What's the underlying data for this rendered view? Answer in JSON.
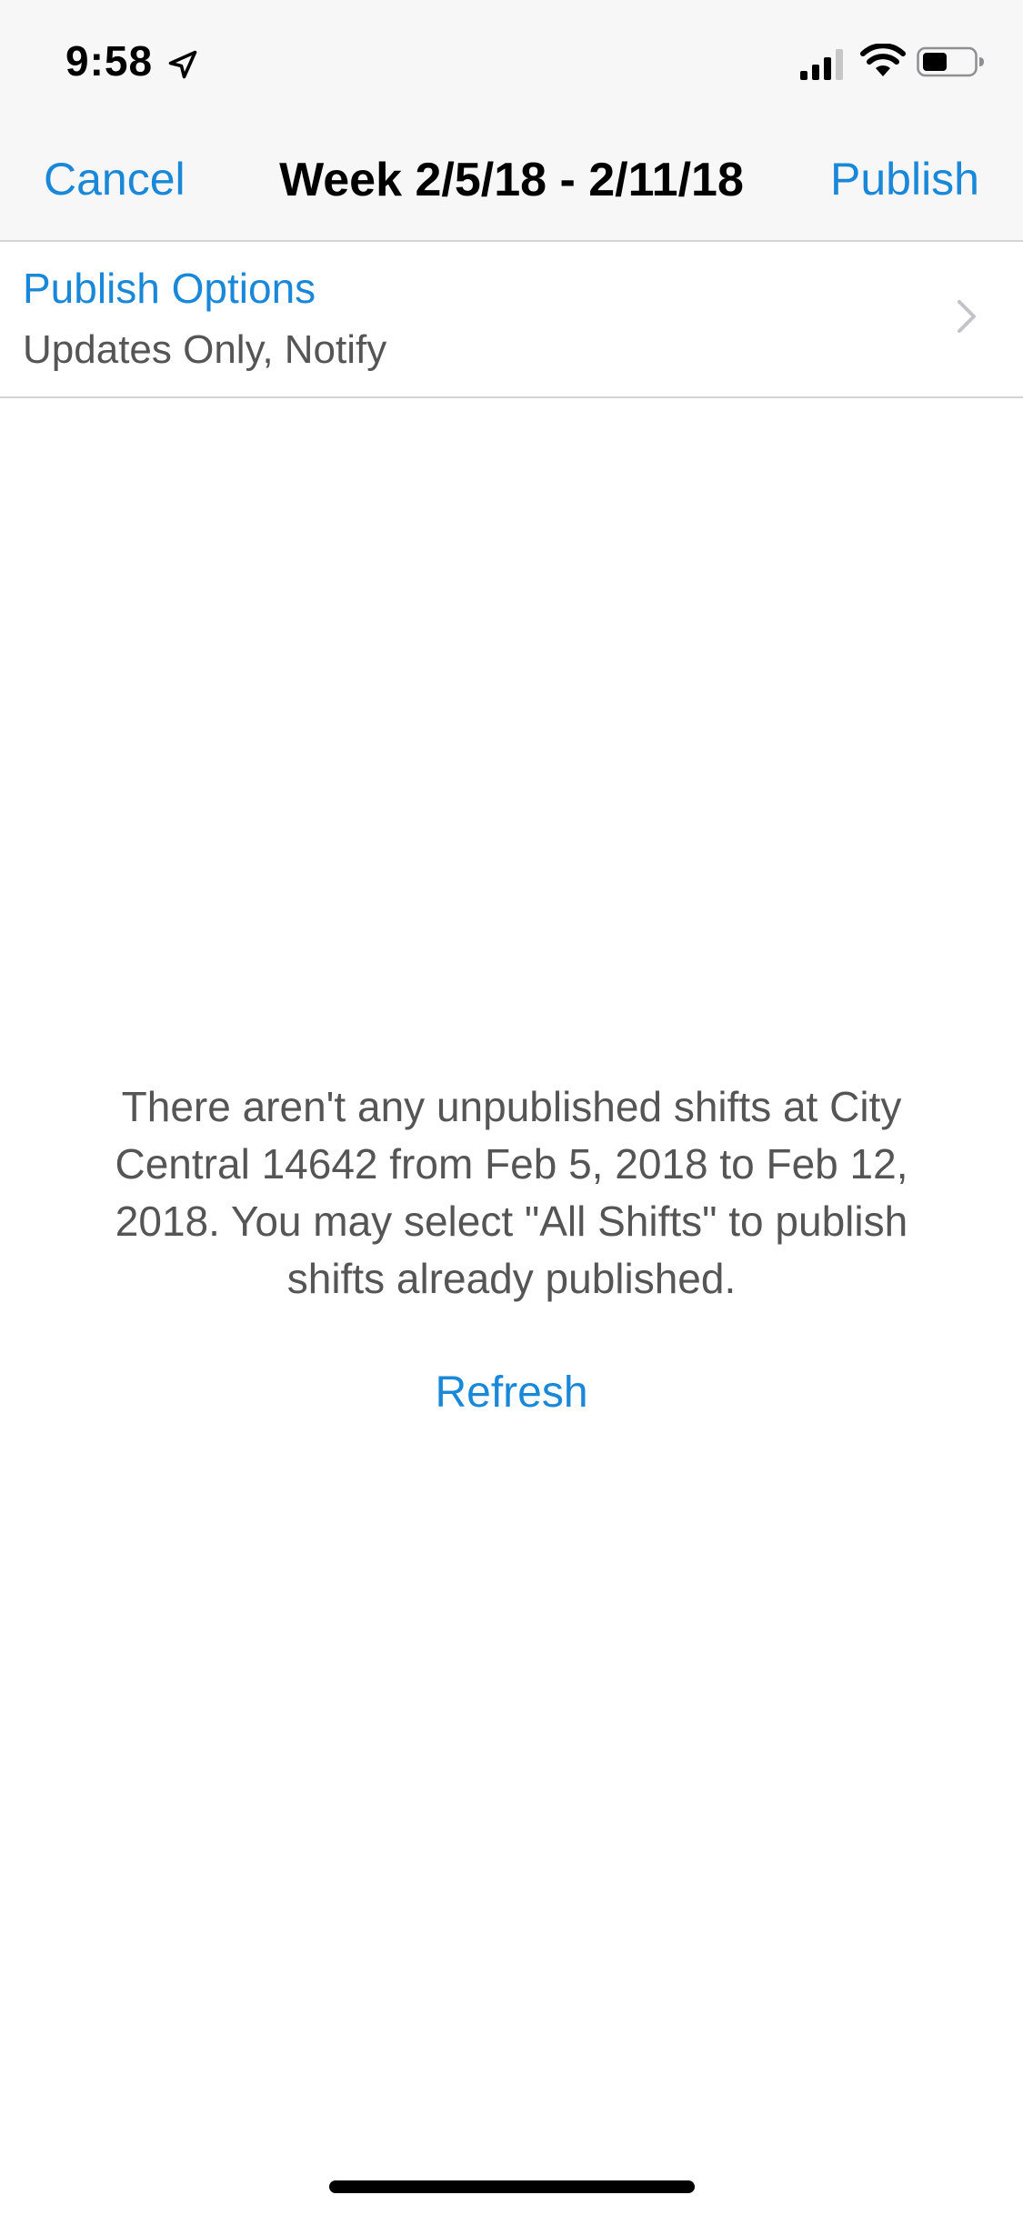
{
  "status_bar": {
    "time": "9:58",
    "icons": [
      "location-arrow-icon",
      "signal-icon",
      "wifi-icon",
      "battery-icon"
    ]
  },
  "nav": {
    "cancel_label": "Cancel",
    "title": "Week 2/5/18 - 2/11/18",
    "publish_label": "Publish"
  },
  "publish_options": {
    "title": "Publish Options",
    "value": "Updates Only, Notify",
    "icon": "chevron-right-icon"
  },
  "empty_state": {
    "message": "There aren't any unpublished shifts at City Central 14642 from Feb 5, 2018 to Feb 12, 2018. You may select \"All Shifts\" to publish shifts already published.",
    "refresh_label": "Refresh"
  },
  "colors": {
    "accent": "#1a88d8",
    "nav_background": "#f7f7f7",
    "secondary_text": "#555555",
    "separator": "#d4d4d6"
  }
}
